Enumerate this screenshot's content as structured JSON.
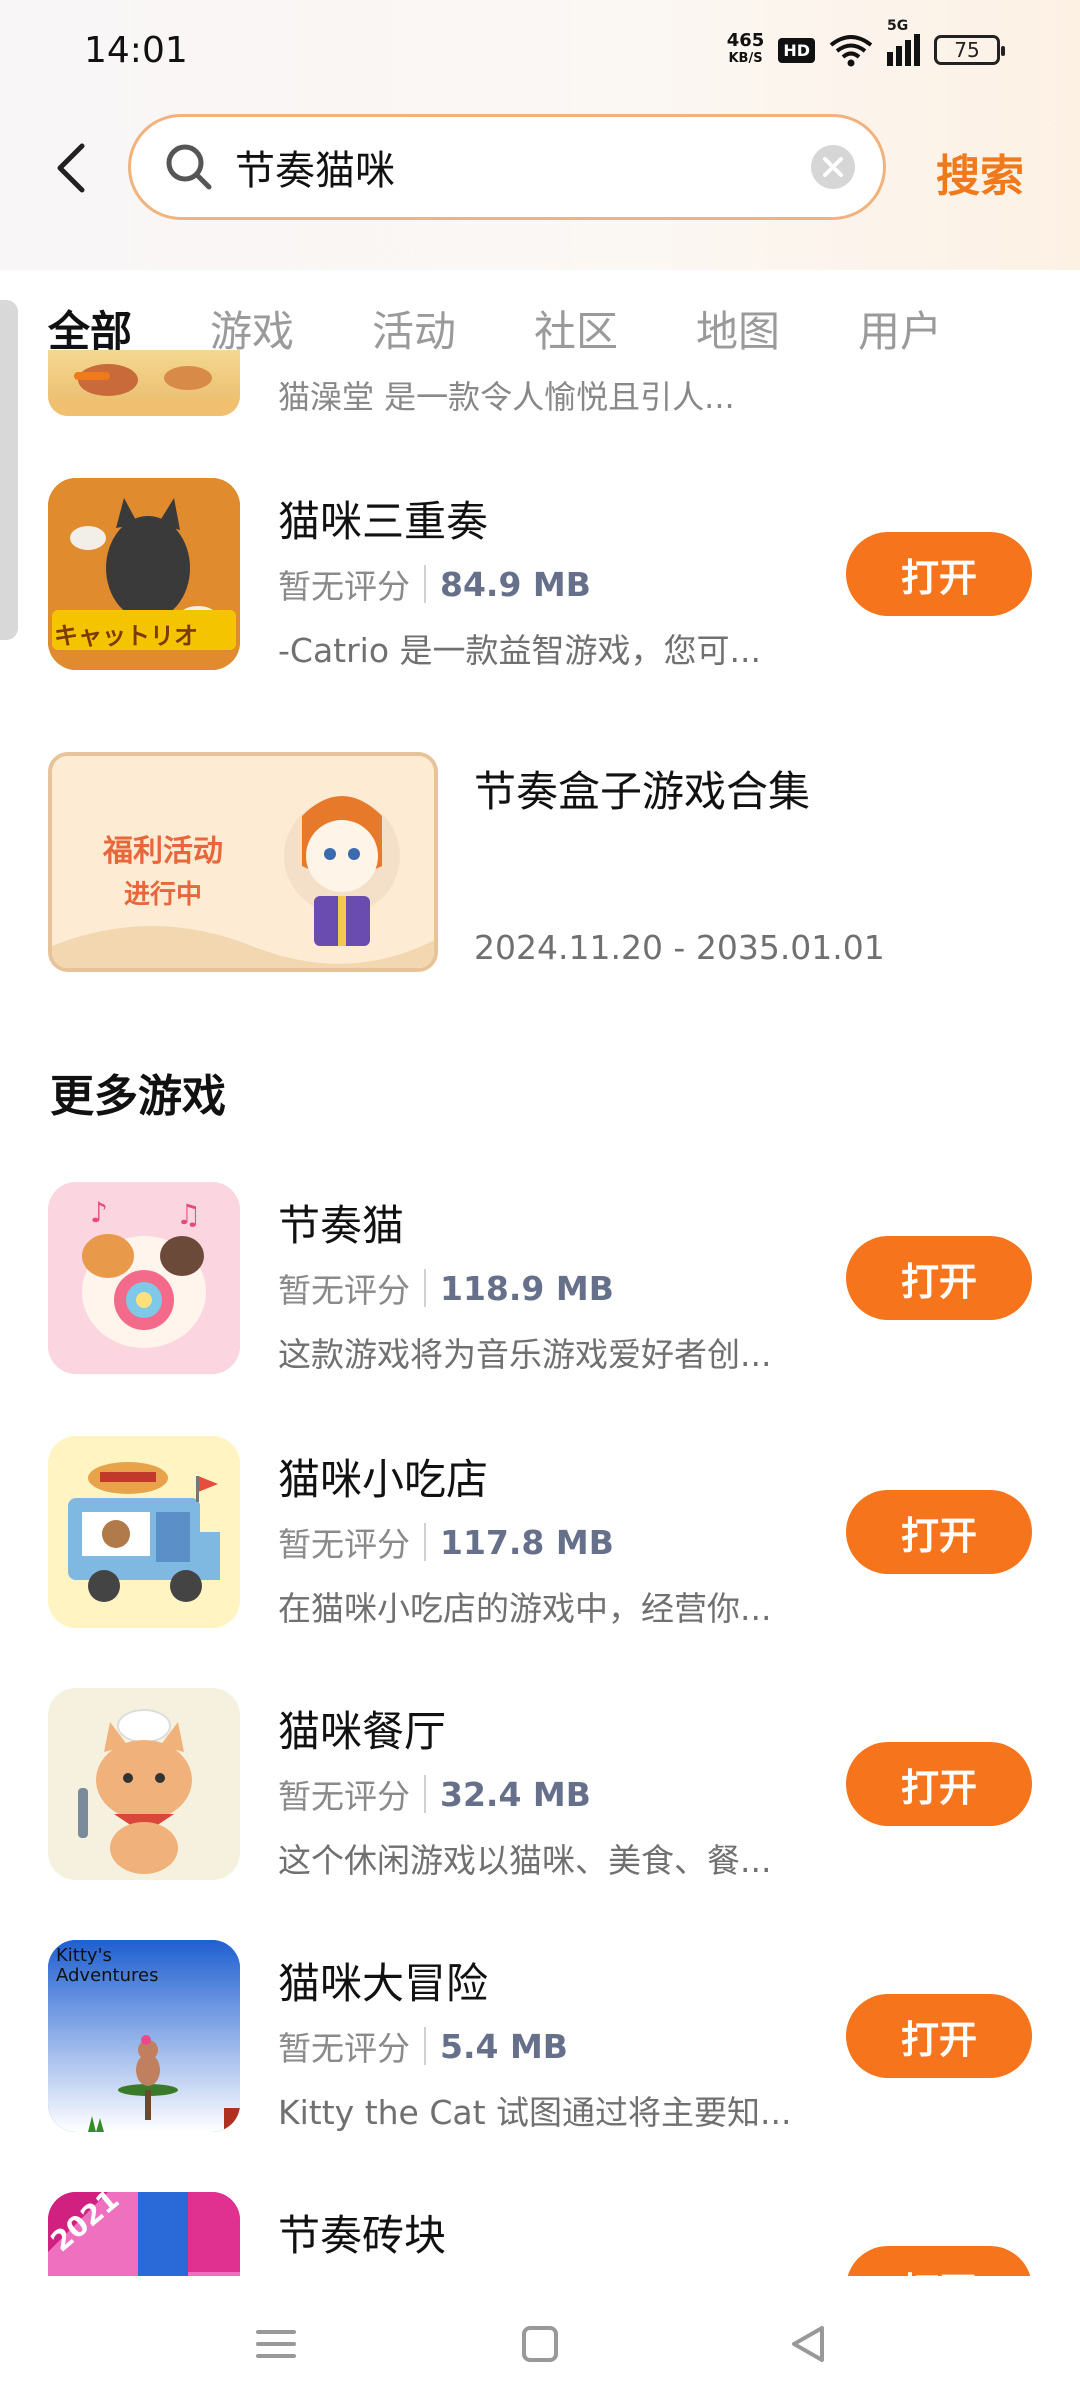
{
  "status_bar": {
    "time": "14:01",
    "net_speed_value": "465",
    "net_speed_unit": "KB/S",
    "hd_label": "HD",
    "signal_label": "5G",
    "battery": "75"
  },
  "search": {
    "query": "节奏猫咪",
    "button_label": "搜索"
  },
  "tabs": [
    {
      "label": "全部",
      "active": true
    },
    {
      "label": "游戏",
      "active": false
    },
    {
      "label": "活动",
      "active": false
    },
    {
      "label": "社区",
      "active": false
    },
    {
      "label": "地图",
      "active": false
    },
    {
      "label": "用户",
      "active": false
    }
  ],
  "partial_item": {
    "description": "猫澡堂 是一款令人愉悦且引人..."
  },
  "apps": [
    {
      "title": "猫咪三重奏",
      "rating": "暂无评分",
      "size": "84.9 MB",
      "description": "-Catrio 是一款益智游戏，您可...",
      "action": "打开",
      "icon_name": "catrio-app-icon",
      "icon_text": "キャットリオ"
    }
  ],
  "event": {
    "title": "节奏盒子游戏合集",
    "date": "2024.11.20 - 2035.01.01",
    "banner_line1": "福利活动",
    "banner_line2": "进行中"
  },
  "more_section": {
    "title": "更多游戏",
    "apps": [
      {
        "title": "节奏猫",
        "rating": "暂无评分",
        "size": "118.9 MB",
        "description": "这款游戏将为音乐游戏爱好者创...",
        "action": "打开",
        "icon_name": "rhythm-cat-app-icon"
      },
      {
        "title": "猫咪小吃店",
        "rating": "暂无评分",
        "size": "117.8 MB",
        "description": "在猫咪小吃店的游戏中，经营你...",
        "action": "打开",
        "icon_name": "cat-snack-shop-app-icon"
      },
      {
        "title": "猫咪餐厅",
        "rating": "暂无评分",
        "size": "32.4 MB",
        "description": "这个休闲游戏以猫咪、美食、餐...",
        "action": "打开",
        "icon_name": "cat-restaurant-app-icon"
      },
      {
        "title": "猫咪大冒险",
        "rating": "暂无评分",
        "size": "5.4 MB",
        "description": "Kitty the Cat 试图通过将主要知...",
        "action": "打开",
        "icon_name": "kitty-adventures-app-icon",
        "icon_text_line1": "Kitty's",
        "icon_text_line2": "Adventures"
      },
      {
        "title": "节奏砖块",
        "action": "打开",
        "icon_name": "rhythm-tiles-app-icon",
        "icon_text": "2021"
      }
    ]
  },
  "colors": {
    "accent": "#f5741c",
    "search_border": "#f2b27b",
    "size_text": "#66708a"
  },
  "nav_bar": {
    "items": [
      "menu-icon",
      "home-icon",
      "back-icon"
    ]
  }
}
